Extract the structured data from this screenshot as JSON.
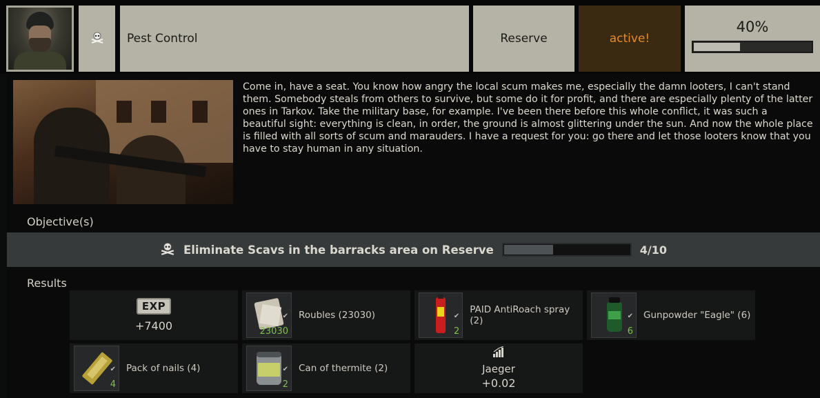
{
  "header": {
    "trader_portrait": "trader-portrait",
    "quest_type_icon": "skull-icon",
    "quest_name": "Pest Control",
    "location": "Reserve",
    "status": "active!",
    "progress_label": "40%",
    "progress_fraction": 0.4
  },
  "description": "Come in, have a seat. You know how angry the local scum makes me, especially the damn looters, I can't stand them. Somebody steals from others to survive, but some do it for profit, and there are especially plenty of the latter ones in Tarkov. Take the military base, for example. I've been there before this whole conflict, it was such a beautiful sight: everything is clean, in order, the ground is almost glittering under the sun. And now the whole place is filled with all sorts of scum and marauders. I have a request for you: go there and let those looters know that you have to stay human in any situation.",
  "objectives": {
    "label": "Objective(s)",
    "items": [
      {
        "icon": "skull-icon",
        "text": "Eliminate Scavs in the barracks area on Reserve",
        "count": "4/10",
        "progress_fraction": 0.4
      }
    ]
  },
  "results": {
    "label": "Results",
    "experience": {
      "badge": "EXP",
      "value": "+7400"
    },
    "items": [
      {
        "name": "Roubles (23030)",
        "qty": "23030",
        "icon": "roubles-icon"
      },
      {
        "name": "PAID AntiRoach spray (2)",
        "qty": "2",
        "icon": "spray-icon"
      },
      {
        "name": "Gunpowder \"Eagle\" (6)",
        "qty": "6",
        "icon": "gunpowder-icon"
      },
      {
        "name": "Pack of nails (4)",
        "qty": "4",
        "icon": "nails-icon"
      },
      {
        "name": "Can of thermite (2)",
        "qty": "2",
        "icon": "thermite-icon"
      }
    ],
    "reputation": {
      "trader": "Jaeger",
      "value": "+0.02",
      "icon": "reputation-icon"
    }
  },
  "colors": {
    "status_text": "#e58a2a",
    "status_bg": "#3a2a12",
    "quantity": "#7fc14a",
    "header_cell": "#b5b3a6"
  }
}
